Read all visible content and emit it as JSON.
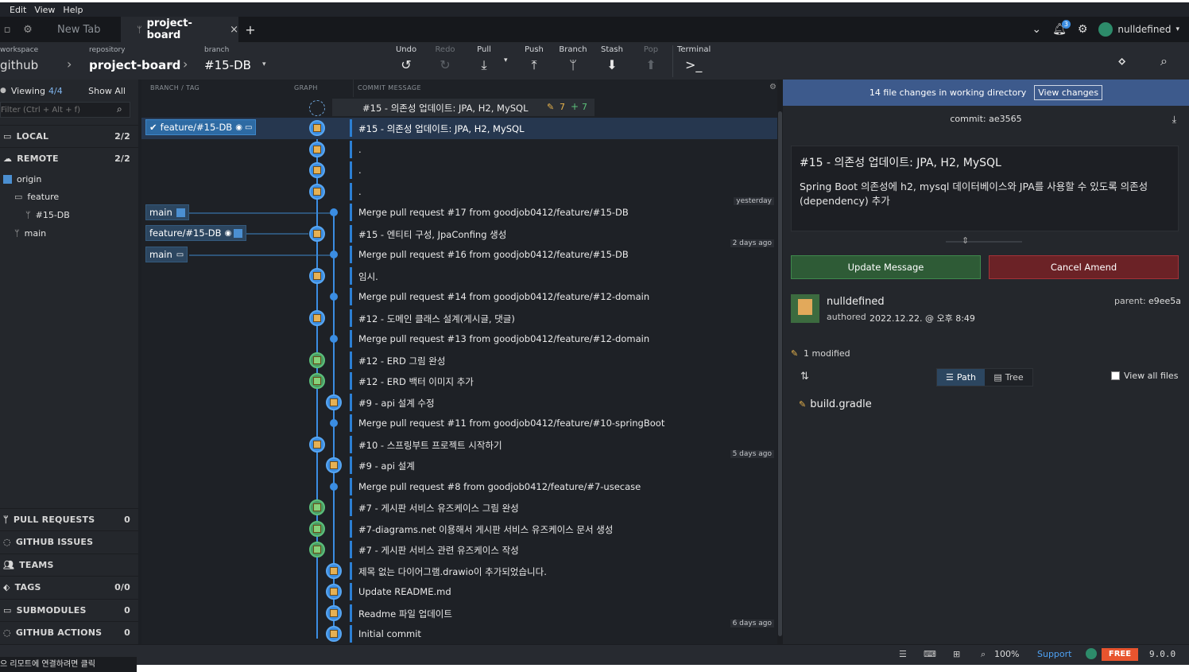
{
  "menu": [
    "Edit",
    "View",
    "Help"
  ],
  "tabs": {
    "new_tab": "New Tab",
    "active": "project-board",
    "close": "×",
    "add": "+"
  },
  "user": {
    "name": "nulldefined",
    "notifications": "3"
  },
  "toolbar": {
    "workspace_label": "workspace",
    "workspace_value": "github",
    "repo_label": "repository",
    "repo_value": "project-board",
    "branch_label": "branch",
    "branch_value": "#15-DB",
    "undo": "Undo",
    "redo": "Redo",
    "pull": "Pull",
    "push": "Push",
    "branch": "Branch",
    "stash": "Stash",
    "pop": "Pop",
    "terminal": "Terminal"
  },
  "sidebar": {
    "viewing": "Viewing",
    "viewing_count": "4/4",
    "show_all": "Show All",
    "filter_placeholder": "Filter (Ctrl + Alt + f)",
    "local": "LOCAL",
    "local_count": "2/2",
    "remote": "REMOTE",
    "remote_count": "2/2",
    "origin": "origin",
    "feature": "feature",
    "branch_15": "#15-DB",
    "main": "main",
    "sections": [
      {
        "label": "PULL REQUESTS",
        "count": "0"
      },
      {
        "label": "GITHUB ISSUES",
        "count": ""
      },
      {
        "label": "TEAMS",
        "count": ""
      },
      {
        "label": "TAGS",
        "count": "0/0"
      },
      {
        "label": "SUBMODULES",
        "count": "0"
      },
      {
        "label": "GITHUB ACTIONS",
        "count": "0"
      }
    ]
  },
  "graph": {
    "col_branch": "BRANCH / TAG",
    "col_graph": "GRAPH",
    "col_msg": "COMMIT MESSAGE",
    "wip_msg": "#15 - 의존성 업데이트: JPA, H2, MySQL",
    "wip_modified": "7",
    "wip_added": "7",
    "refs": {
      "feature_15": "feature/#15-DB",
      "main": "main",
      "feature_remote": "feature/#15-DB"
    },
    "time_tags": [
      "yesterday",
      "2 days ago",
      "5 days ago",
      "6 days ago"
    ],
    "commits": [
      "#15 - 의존성 업데이트: JPA, H2, MySQL",
      ".",
      ".",
      ".",
      "Merge pull request #17 from goodjob0412/feature/#15-DB",
      "#15 - 엔티티 구성, JpaConfing 생성",
      "Merge pull request #16 from goodjob0412/feature/#15-DB",
      "임시.",
      "Merge pull request #14 from goodjob0412/feature/#12-domain",
      "#12 - 도메인 클래스 설계(게시글, 댓글)",
      "Merge pull request #13 from goodjob0412/feature/#12-domain",
      "#12 - ERD 그림 완성",
      "#12 - ERD 백터 이미지 추가",
      "#9 - api 설계 수정",
      "Merge pull request #11 from goodjob0412/feature/#10-springBoot",
      "#10 - 스프링부트 프로젝트 시작하기",
      "#9 - api 설계",
      "Merge pull request #8 from goodjob0412/feature/#7-usecase",
      "#7 - 게시판 서비스 유즈케이스 그림 완성",
      "#7-diagrams.net 이용해서 게시판 서비스 유즈케이스 문서 생성",
      "#7 - 게시판 서비스 관련 유즈케이스 작성",
      "제목 없는 다이어그램.drawio이 추가되었습니다.",
      "Update README.md",
      "Readme 파일 업데이트",
      "Initial commit"
    ]
  },
  "detail": {
    "banner": "14 file changes in working directory",
    "view_changes": "View changes",
    "commit_label": "commit:",
    "commit_sha": "ae3565",
    "summary": "#15 - 의존성 업데이트: JPA, H2, MySQL",
    "description": "Spring Boot 의존성에 h2, mysql 데이터베이스와 JPA를 사용할 수 있도록 의존성(dependency) 추가",
    "update_btn": "Update Message",
    "cancel_btn": "Cancel Amend",
    "author": "nulldefined",
    "authored": "authored",
    "date": "2022.12.22. @ 오후 8:49",
    "parent_label": "parent:",
    "parent_sha": "e9ee5a",
    "modified_count": "1 modified",
    "path_tab": "Path",
    "tree_tab": "Tree",
    "view_all": "View all files",
    "file": "build.gradle"
  },
  "statusbar": {
    "zoom": "100%",
    "support": "Support",
    "free": "FREE",
    "version": "9.0.0"
  },
  "bottom_tooltip": "으 리모트에 연결하려면 클릭"
}
